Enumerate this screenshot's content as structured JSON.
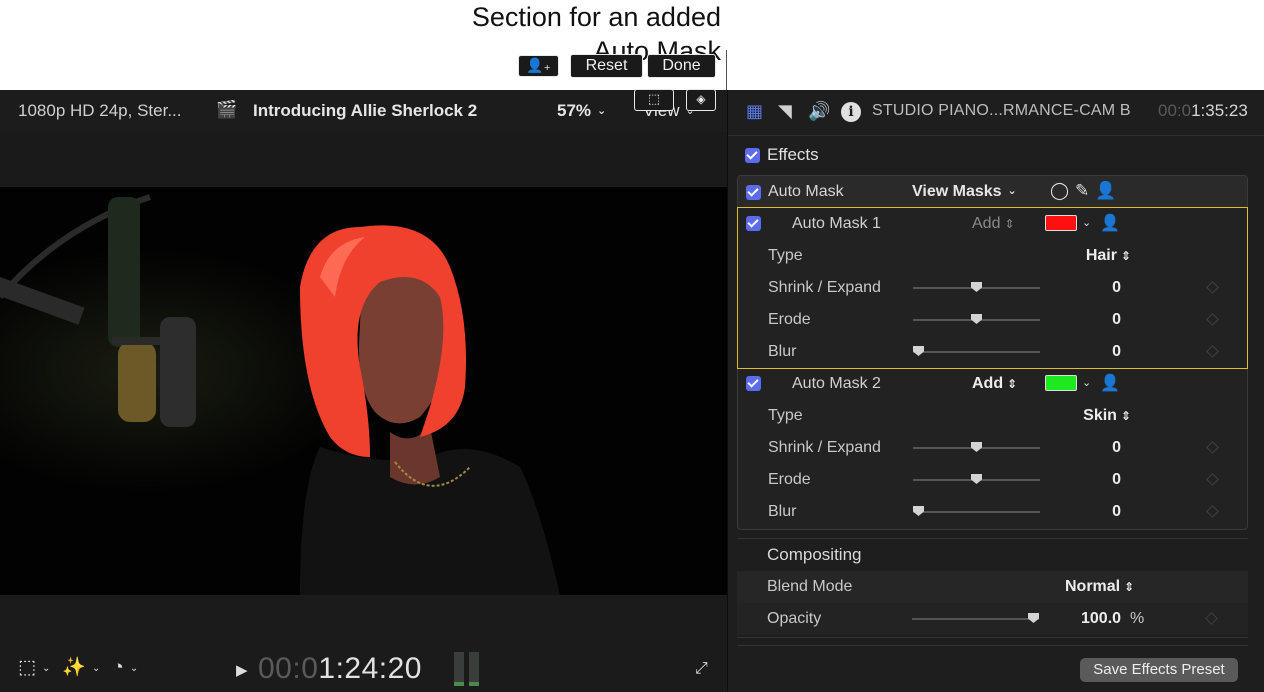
{
  "callout": {
    "line1": "Section for an added",
    "line2": "Auto Mask"
  },
  "viewer": {
    "format": "1080p HD 24p, Ster...",
    "title": "Introducing Allie Sherlock 2",
    "zoom": "57%",
    "view_label": "View",
    "reset_label": "Reset",
    "done_label": "Done",
    "timecode_dim": "00:0",
    "timecode": "1:24:20"
  },
  "inspector": {
    "clip_name": "STUDIO PIANO...RMANCE-CAM B",
    "timecode_dim": "00:0",
    "timecode": "1:35:23",
    "effects_label": "Effects",
    "auto_mask": {
      "label": "Auto Mask",
      "view_masks_label": "View Masks",
      "masks": [
        {
          "name": "Auto Mask 1",
          "mode": "Add",
          "color": "#ff1010",
          "type_label": "Type",
          "type_value": "Hair",
          "params": [
            {
              "label": "Shrink / Expand",
              "value": "0",
              "slider": 0.5
            },
            {
              "label": "Erode",
              "value": "0",
              "slider": 0.5
            },
            {
              "label": "Blur",
              "value": "0",
              "slider": 0.0
            }
          ]
        },
        {
          "name": "Auto Mask 2",
          "mode": "Add",
          "color": "#1ee81e",
          "type_label": "Type",
          "type_value": "Skin",
          "params": [
            {
              "label": "Shrink / Expand",
              "value": "0",
              "slider": 0.5
            },
            {
              "label": "Erode",
              "value": "0",
              "slider": 0.5
            },
            {
              "label": "Blur",
              "value": "0",
              "slider": 0.0
            }
          ]
        }
      ]
    },
    "compositing": {
      "title": "Compositing",
      "blend_label": "Blend Mode",
      "blend_value": "Normal",
      "opacity_label": "Opacity",
      "opacity_value": "100.0",
      "opacity_unit": "%",
      "opacity_slider": 1.0
    },
    "save_preset_label": "Save Effects Preset"
  }
}
